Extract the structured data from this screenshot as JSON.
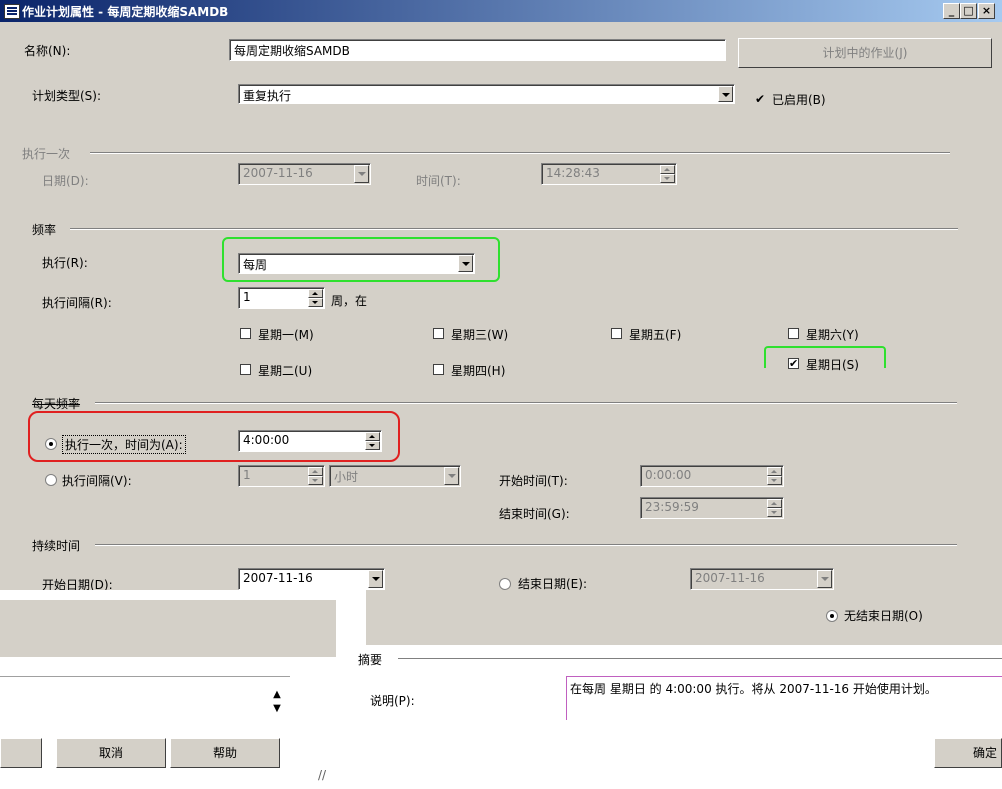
{
  "window": {
    "title": "作业计划属性 - 每周定期收缩SAMDB",
    "controls": [
      "_",
      "□",
      "×"
    ]
  },
  "name_label": "名称(N):",
  "name_value": "每周定期收缩SAMDB",
  "jobs_in_schedule_button": "计划中的作业(J)",
  "schedule_type_label": "计划类型(S):",
  "schedule_type_value": "重复执行",
  "enabled_label": "已启用(B)",
  "enabled_checked": true,
  "one_time": {
    "section": "执行一次",
    "date_label": "日期(D):",
    "date_value": "2007-11-16",
    "time_label": "时间(T):",
    "time_value": "14:28:43"
  },
  "frequency": {
    "section": "频率",
    "occurs_label": "执行(R):",
    "occurs_value": "每周",
    "recurs_label": "执行间隔(R):",
    "recurs_value": "1",
    "recurs_unit": "周，在",
    "days": [
      {
        "label": "星期一(M)",
        "checked": false
      },
      {
        "label": "星期三(W)",
        "checked": false
      },
      {
        "label": "星期五(F)",
        "checked": false
      },
      {
        "label": "星期六(Y)",
        "checked": false
      },
      {
        "label": "星期二(U)",
        "checked": false
      },
      {
        "label": "星期四(H)",
        "checked": false
      },
      {
        "label": "星期日(S)",
        "checked": true
      }
    ]
  },
  "daily": {
    "section": "每天频率",
    "once_label": "执行一次，时间为(A):",
    "once_value": "4:00:00",
    "every_label": "执行间隔(V):",
    "every_value": "1",
    "every_unit": "小时",
    "start_label": "开始时间(T):",
    "start_value": "0:00:00",
    "end_label": "结束时间(G):",
    "end_value": "23:59:59"
  },
  "duration": {
    "section": "持续时间",
    "start_label": "开始日期(D):",
    "start_value": "2007-11-16",
    "end_date_label": "结束日期(E):",
    "end_date_value": "2007-11-16",
    "no_end_label": "无结束日期(O)"
  },
  "summary": {
    "section": "摘要",
    "description_label": "说明(P):",
    "description_value": "在每周 星期日 的 4:00:00 执行。将从 2007-11-16 开始使用计划。"
  },
  "buttons": {
    "cancel": "取消",
    "help": "帮助",
    "ok": "确定"
  },
  "colors": {
    "titlebar_start": "#0a246a",
    "titlebar_end": "#a6caf0",
    "dialog_bg": "#d4d0c8",
    "highlight_green": "#2fe02f",
    "highlight_red": "#e02020"
  }
}
